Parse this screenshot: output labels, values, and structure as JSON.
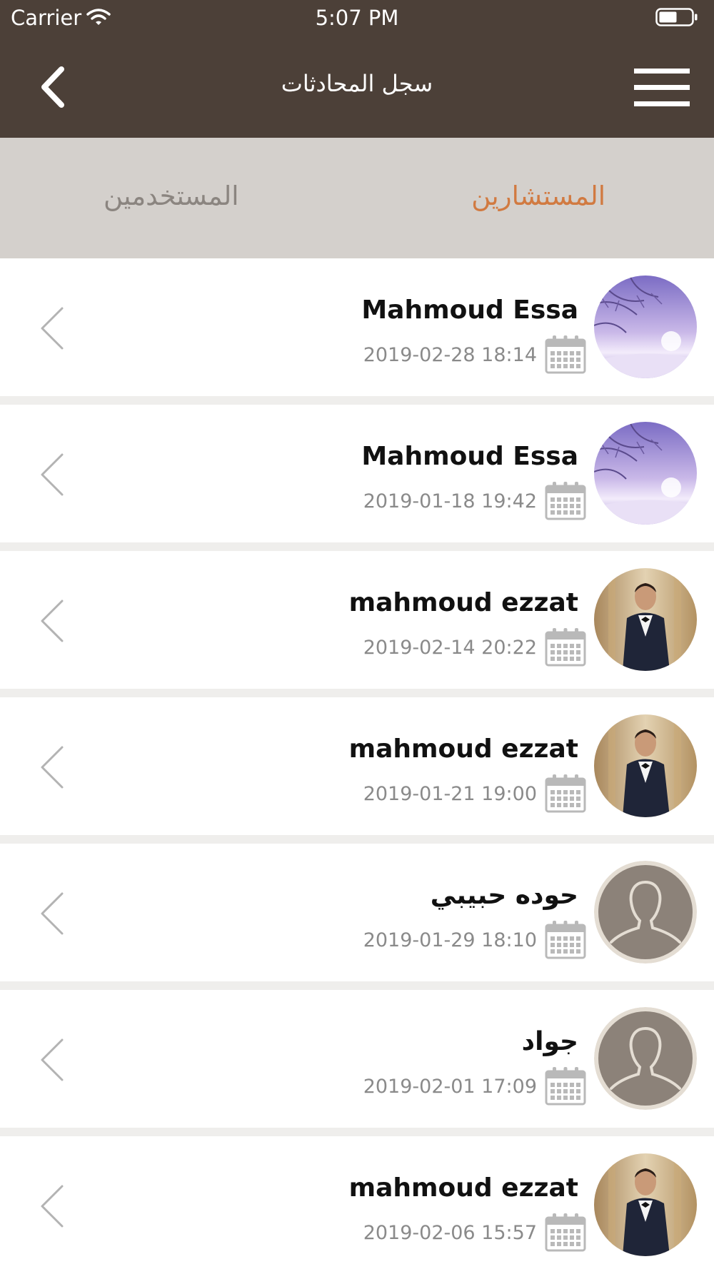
{
  "status_bar": {
    "carrier": "Carrier",
    "time": "5:07 PM"
  },
  "nav": {
    "title": "سجل المحادثات",
    "back_icon": "chevron-left-icon",
    "menu_icon": "hamburger-menu-icon"
  },
  "tabs": {
    "users": "المستخدمين",
    "consultants": "المستشارين",
    "active": "consultants",
    "active_color": "#d17a41",
    "inactive_color": "#8b8580"
  },
  "colors": {
    "header_bg": "#4c4038",
    "tabs_bg": "#d4d0cc",
    "row_bg": "#ffffff",
    "separator": "#efeeec"
  },
  "conversations": [
    {
      "name": "Mahmoud Essa",
      "date": "2019-02-28 18:14",
      "avatar": "winter-landscape"
    },
    {
      "name": "Mahmoud Essa",
      "date": "2019-01-18 19:42",
      "avatar": "winter-landscape"
    },
    {
      "name": "mahmoud ezzat",
      "date": "2019-02-14 20:22",
      "avatar": "man-in-suit"
    },
    {
      "name": "mahmoud ezzat",
      "date": "2019-01-21 19:00",
      "avatar": "man-in-suit"
    },
    {
      "name": "حوده حبيبي",
      "date": "2019-01-29 18:10",
      "avatar": "default-user"
    },
    {
      "name": "جواد",
      "date": "2019-02-01 17:09",
      "avatar": "default-user"
    },
    {
      "name": "mahmoud ezzat",
      "date": "2019-02-06 15:57",
      "avatar": "man-in-suit"
    }
  ]
}
